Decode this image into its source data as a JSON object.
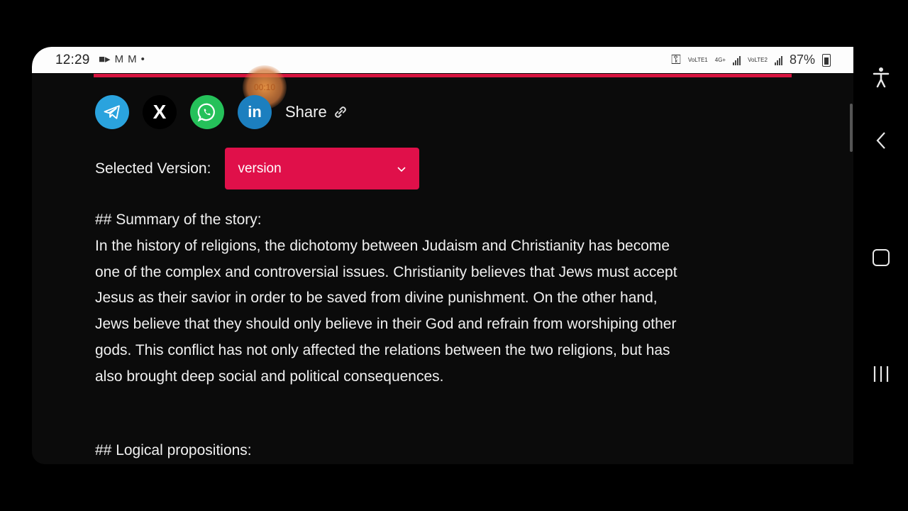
{
  "status_bar": {
    "time": "12:29",
    "network_label_1": "VoLTE1",
    "network_label_2": "4G+",
    "network_label_3": "VoLTE2",
    "battery": "87%"
  },
  "video_timer": "00:10",
  "share": {
    "label": "Share",
    "icons": [
      "telegram-icon",
      "x-icon",
      "whatsapp-icon",
      "linkedin-icon",
      "link-icon"
    ],
    "x_glyph": "X",
    "linkedin_glyph": "in"
  },
  "version": {
    "label": "Selected Version:",
    "value": "version"
  },
  "summary": {
    "heading": "## Summary of the story:",
    "lines": [
      "In the history of religions, the dichotomy between Judaism and Christianity has become",
      "one of the complex and controversial issues. Christianity believes that Jews must accept",
      "Jesus as their savior in order to be saved from divine punishment. On the other hand,",
      "Jews believe that they should only believe in their God and refrain from worshiping other",
      "gods. This conflict has not only affected the relations between the two religions, but has",
      "also brought deep social and political consequences."
    ]
  },
  "logical": {
    "heading": "## Logical propositions:"
  },
  "colors": {
    "accent": "#e0104a",
    "progress": "#d6143f",
    "telegram": "#2aa3de",
    "whatsapp": "#25c15a",
    "linkedin": "#1c7fbf"
  }
}
